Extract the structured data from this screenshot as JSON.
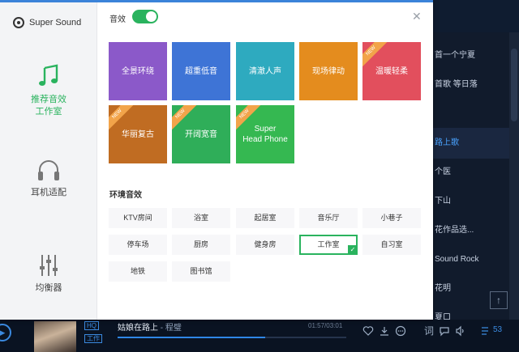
{
  "background_list": {
    "items": [
      {
        "label": "首一个宁夏",
        "active": false
      },
      {
        "label": "首歌 等日落",
        "active": false
      },
      {
        "label": "",
        "active": false
      },
      {
        "label": "路上歌",
        "active": true
      },
      {
        "label": "个医",
        "active": false
      },
      {
        "label": "下山",
        "active": false
      },
      {
        "label": "花作品选...",
        "active": false
      },
      {
        "label": "Sound Rock",
        "active": false
      },
      {
        "label": "花明",
        "active": false
      },
      {
        "label": "夏口",
        "active": false
      }
    ]
  },
  "dialog": {
    "brand": "Super Sound",
    "sidebar": [
      {
        "label_line1": "推荐音效",
        "label_line2": "工作室",
        "icon": "music-note-icon"
      },
      {
        "label_line1": "耳机适配",
        "label_line2": "",
        "icon": "headphones-icon"
      },
      {
        "label_line1": "均衡器",
        "label_line2": "",
        "icon": "equalizer-icon"
      }
    ],
    "effect_label": "音效",
    "effect_enabled": true,
    "tiles": [
      {
        "label": "全景环绕",
        "color": "#8b59c9",
        "new": false
      },
      {
        "label": "超重低音",
        "color": "#3e74d6",
        "new": false
      },
      {
        "label": "清澈人声",
        "color": "#2eaabf",
        "new": false
      },
      {
        "label": "现场律动",
        "color": "#e48c1e",
        "new": false
      },
      {
        "label": "温暖轻柔",
        "color": "#e24f5d",
        "new": true
      },
      {
        "label": "华丽复古",
        "color": "#c06c22",
        "new": true
      },
      {
        "label": "开阔宽音",
        "color": "#2fae59",
        "new": true
      },
      {
        "label": "Super\nHead Phone",
        "color": "#35b851",
        "new": true
      }
    ],
    "new_tag": "NEW",
    "env_title": "环境音效",
    "env_items": [
      {
        "label": "KTV房间",
        "selected": false
      },
      {
        "label": "浴室",
        "selected": false
      },
      {
        "label": "起居室",
        "selected": false
      },
      {
        "label": "音乐厅",
        "selected": false
      },
      {
        "label": "小巷子",
        "selected": false
      },
      {
        "label": "停车场",
        "selected": false
      },
      {
        "label": "厨房",
        "selected": false
      },
      {
        "label": "健身房",
        "selected": false
      },
      {
        "label": "工作室",
        "selected": true
      },
      {
        "label": "自习室",
        "selected": false
      },
      {
        "label": "地铁",
        "selected": false
      },
      {
        "label": "图书馆",
        "selected": false
      }
    ]
  },
  "player": {
    "song_title": "姑娘在路上",
    "artist": "- 程璧",
    "badge_hq": "HQ",
    "badge_studio": "工作",
    "time": "01:57/03:01",
    "progress": 0.647,
    "count": "53",
    "lyrics_label": "词"
  }
}
